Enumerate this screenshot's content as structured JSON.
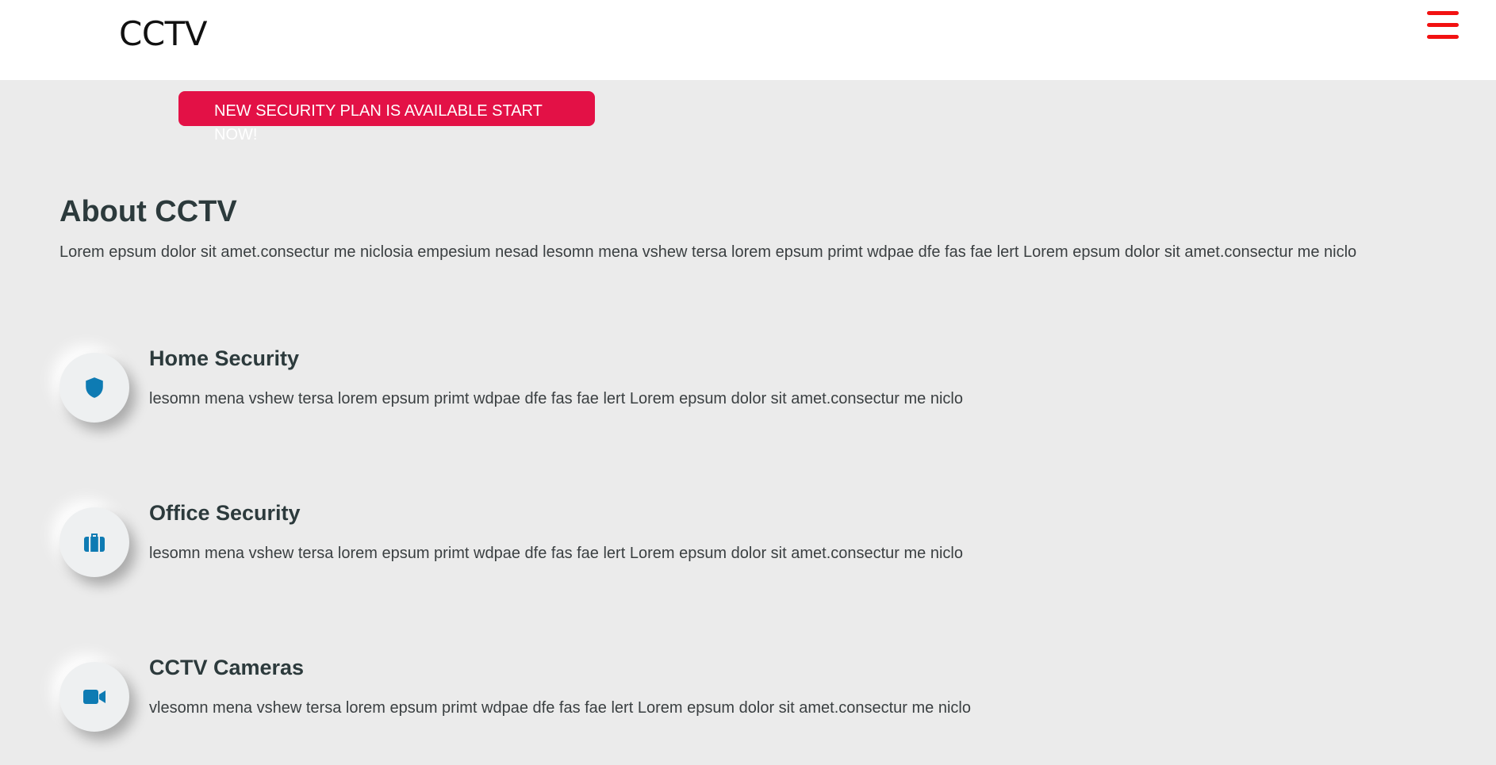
{
  "header": {
    "logo": "CCTV",
    "menu_icon": "hamburger-menu-icon"
  },
  "banner": {
    "text": "NEW SECURITY PLAN IS AVAILABLE START NOW!"
  },
  "about": {
    "title": "About CCTV",
    "text": "Lorem epsum dolor sit amet.consectur me niclosia empesium nesad lesomn mena vshew tersa lorem epsum primt wdpae dfe fas fae lert Lorem epsum dolor sit amet.consectur me niclo"
  },
  "services": [
    {
      "icon": "shield-icon",
      "title": "Home Security",
      "text": "lesomn mena vshew tersa lorem epsum primt wdpae dfe fas fae lert Lorem epsum dolor sit amet.consectur me niclo"
    },
    {
      "icon": "briefcase-icon",
      "title": "Office Security",
      "text": "lesomn mena vshew tersa lorem epsum primt wdpae dfe fas fae lert Lorem epsum dolor sit amet.consectur me niclo"
    },
    {
      "icon": "video-camera-icon",
      "title": "CCTV Cameras",
      "text": "vlesomn mena vshew tersa lorem epsum primt wdpae dfe fas fae lert Lorem epsum dolor sit amet.consectur me niclo"
    }
  ],
  "colors": {
    "brand_red": "#e31146",
    "menu_red": "#f21111",
    "icon_blue": "#0e7bb3",
    "background": "#ebebeb"
  }
}
